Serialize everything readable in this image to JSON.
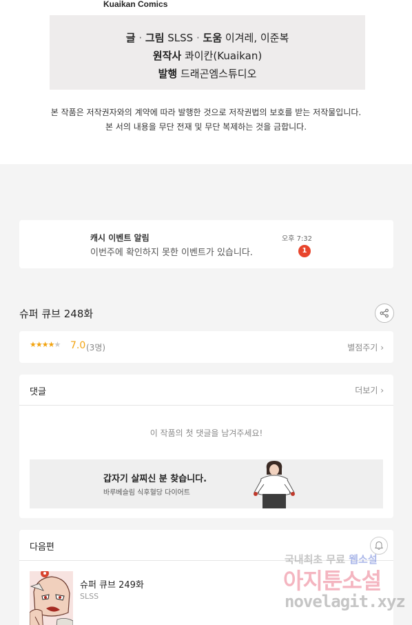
{
  "publisher_label": "Kuaikan Comics",
  "credits": {
    "line1": {
      "k1": "글",
      "sep1": "·",
      "k2": "그림",
      "v1": "SLSS",
      "sep2": "·",
      "k3": "도움",
      "v2": "이겨레, 이준복"
    },
    "line2": {
      "k": "원작사",
      "v": "콰이칸(Kuaikan)"
    },
    "line3": {
      "k": "발행",
      "v": "드래곤엠스튜디오"
    }
  },
  "copyright_notice": {
    "line1": "본 작품은 저작권자와의 계약에 따라 발행한 것으로 저작권법의 보호를 받는 저작물입니다.",
    "line2": "본 서의 내용을 무단 전재 및 무단 복제하는 것을 금합니다."
  },
  "alarm": {
    "title": "캐시 이벤트 알림",
    "message": "이번주에 확인하지 못한 이벤트가 있습니다.",
    "time": "오후 7:32",
    "badge_count": "1",
    "badge_color": "#e8452c"
  },
  "episode": {
    "title": "슈퍼 큐브 248화",
    "share_icon": "share-icon"
  },
  "rating": {
    "stars_value": 3.5,
    "stars_max": 5,
    "score": "7.0",
    "count": "(3명)",
    "rate_link": "별점주기",
    "accent_color": "#f2a30f"
  },
  "comments": {
    "title": "댓글",
    "more_link": "더보기",
    "empty_message": "이 작품의 첫 댓글을 남겨주세요!",
    "ad": {
      "title": "갑자기 살찌신 분 찾습니다.",
      "subtitle": "바루베슬림 식후혈당 다이어트"
    }
  },
  "next_episode": {
    "section_title": "다음편",
    "title": "슈퍼 큐브 249화",
    "author": "SLSS"
  },
  "watermark": {
    "line1a": "국내최초 무료 ",
    "line1b": "웹소설",
    "line2": "아지툰소설",
    "line3": "novelagit.xyz"
  }
}
